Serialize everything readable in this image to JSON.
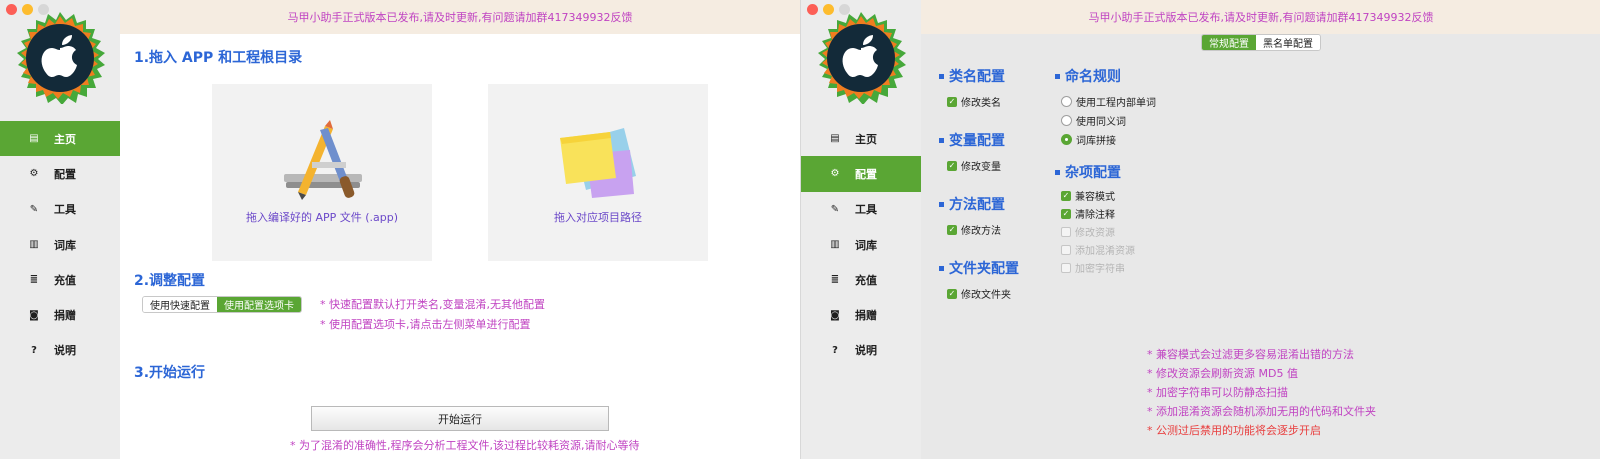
{
  "banner": {
    "text": "马甲小助手正式版本已发布,请及时更新,有问题请加群417349932反馈"
  },
  "colors": {
    "accent": "#5aa634",
    "title": "#2c66d6",
    "note": "#c043c2",
    "warning": "#e83e3e"
  },
  "nav": {
    "items": [
      {
        "label": "主页",
        "icon": "document-icon"
      },
      {
        "label": "配置",
        "icon": "gear-icon"
      },
      {
        "label": "工具",
        "icon": "wand-icon"
      },
      {
        "label": "词库",
        "icon": "book-icon"
      },
      {
        "label": "充值",
        "icon": "database-icon"
      },
      {
        "label": "捐赠",
        "icon": "money-icon"
      },
      {
        "label": "说明",
        "icon": "help-icon"
      }
    ]
  },
  "home": {
    "step1_title": "1.拖入 APP 和工程根目录",
    "drop_app_label": "拖入编译好的 APP 文件 (.app)",
    "drop_project_label": "拖入对应项目路径",
    "step2_title": "2.调整配置",
    "config_options": [
      "使用快速配置",
      "使用配置选项卡"
    ],
    "config_selected": "使用配置选项卡",
    "notes": [
      "* 快速配置默认打开类名,变量混淆,无其他配置",
      "* 使用配置选项卡,请点击左侧菜单进行配置"
    ],
    "step3_title": "3.开始运行",
    "start_button": "开始运行",
    "start_note": "* 为了混淆的准确性,程序会分析工程文件,该过程比较耗资源,请耐心等待"
  },
  "settings": {
    "tabs": [
      "常规配置",
      "黑名单配置"
    ],
    "active_tab": "常规配置",
    "class_title": "类名配置",
    "class_option": "修改类名",
    "variable_title": "变量配置",
    "variable_option": "修改变量",
    "method_title": "方法配置",
    "method_option": "修改方法",
    "folder_title": "文件夹配置",
    "folder_option": "修改文件夹",
    "naming_title": "命名规则",
    "naming_options": [
      "使用工程内部单词",
      "使用同义词",
      "词库拼接"
    ],
    "naming_selected": "词库拼接",
    "misc_title": "杂项配置",
    "misc_options": [
      {
        "label": "兼容模式",
        "checked": true,
        "enabled": true
      },
      {
        "label": "清除注释",
        "checked": true,
        "enabled": true
      },
      {
        "label": "修改资源",
        "checked": false,
        "enabled": false
      },
      {
        "label": "添加混淆资源",
        "checked": false,
        "enabled": false
      },
      {
        "label": "加密字符串",
        "checked": false,
        "enabled": false
      }
    ],
    "notes": [
      "* 兼容模式会过滤更多容易混淆出错的方法",
      "* 修改资源会刷新资源 MD5 值",
      "* 加密字符串可以防静态扫描",
      "* 添加混淆资源会随机添加无用的代码和文件夹"
    ],
    "warning": "* 公测过后禁用的功能将会逐步开启"
  }
}
